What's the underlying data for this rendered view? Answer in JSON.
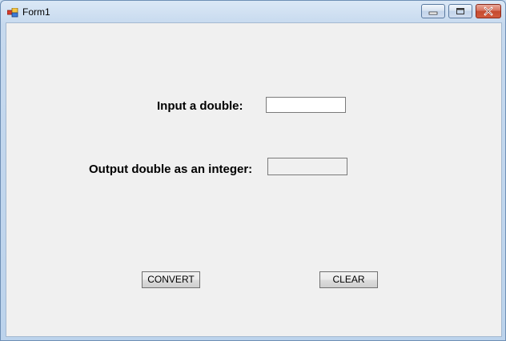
{
  "window": {
    "title": "Form1",
    "icon": "winforms-app-icon",
    "controls": {
      "minimize_icon": "minimize-icon",
      "maximize_icon": "maximize-icon",
      "close_icon": "close-icon"
    }
  },
  "form": {
    "input_label": "Input a double:",
    "input_value": "",
    "output_label": "Output double as an integer:",
    "output_value": "",
    "convert_label": "CONVERT",
    "clear_label": "CLEAR"
  },
  "colors": {
    "client_background": "#f0f0f0",
    "close_button": "#c44a2f",
    "title_bar": "#c6d9ee"
  }
}
